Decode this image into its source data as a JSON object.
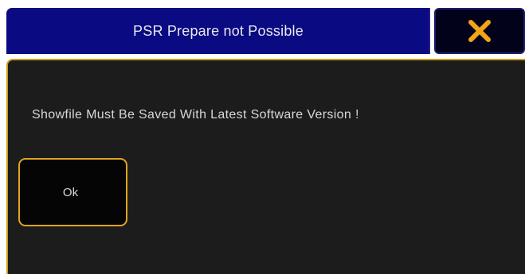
{
  "dialog": {
    "title": "PSR Prepare not Possible",
    "message": "Showfile Must Be Saved With Latest Software Version !",
    "ok_label": "Ok",
    "close_icon": "close-x-icon"
  },
  "colors": {
    "title_background": "#0a0a82",
    "body_background": "#1c1c1c",
    "accent_border": "#d19b18",
    "close_icon": "#f2a516"
  }
}
